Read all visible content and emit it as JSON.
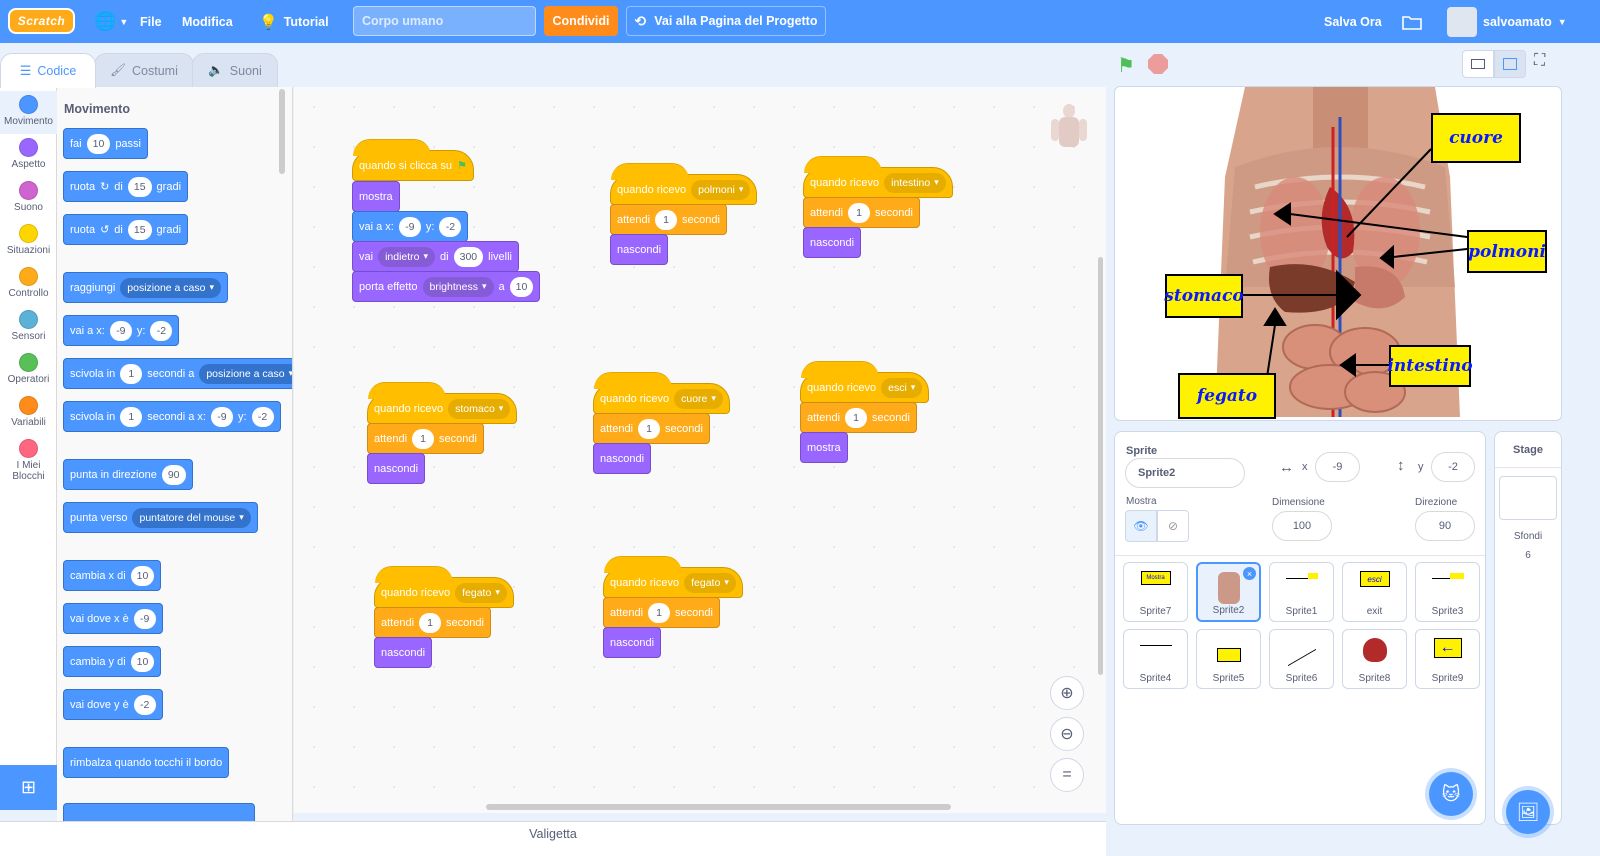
{
  "menubar": {
    "logo": "Scratch",
    "language_icon": "globe-icon",
    "file": "File",
    "edit": "Modifica",
    "tutorial": "Tutorial",
    "project_title": "Corpo umano",
    "share": "Condividi",
    "project_page": "Vai alla Pagina del Progetto",
    "save_now": "Salva Ora",
    "username": "salvoamato",
    "accent": "#4c97ff"
  },
  "tabs": {
    "code": "Codice",
    "costumes": "Costumi",
    "sounds": "Suoni"
  },
  "categories": [
    {
      "label": "Movimento",
      "color": "#4c97ff"
    },
    {
      "label": "Aspetto",
      "color": "#9966ff"
    },
    {
      "label": "Suono",
      "color": "#cf63cf"
    },
    {
      "label": "Situazioni",
      "color": "#ffd500"
    },
    {
      "label": "Controllo",
      "color": "#ffab19"
    },
    {
      "label": "Sensori",
      "color": "#5cb1d6"
    },
    {
      "label": "Operatori",
      "color": "#59c059"
    },
    {
      "label": "Variabili",
      "color": "#ff8c1a"
    },
    {
      "label": "I Miei Blocchi",
      "color": "#ff6680"
    }
  ],
  "palette": {
    "title": "Movimento",
    "move": {
      "a": "fai",
      "n": "10",
      "b": "passi"
    },
    "turn_right": {
      "a": "ruota",
      "b": "di",
      "n": "15",
      "c": "gradi"
    },
    "turn_left": {
      "a": "ruota",
      "b": "di",
      "n": "15",
      "c": "gradi"
    },
    "goto": {
      "a": "raggiungi",
      "opt": "posizione a caso"
    },
    "gotoxy": {
      "a": "vai a x:",
      "x": "-9",
      "b": "y:",
      "y": "-2"
    },
    "glide": {
      "a": "scivola in",
      "n": "1",
      "b": "secondi a",
      "opt": "posizione a caso"
    },
    "glidexy": {
      "a": "scivola in",
      "n": "1",
      "b": "secondi a x:",
      "x": "-9",
      "c": "y:",
      "y": "-2"
    },
    "point_dir": {
      "a": "punta in direzione",
      "n": "90"
    },
    "point_to": {
      "a": "punta verso",
      "opt": "puntatore del mouse"
    },
    "change_x": {
      "a": "cambia x di",
      "n": "10"
    },
    "set_x": {
      "a": "vai dove x è",
      "n": "-9"
    },
    "change_y": {
      "a": "cambia y di",
      "n": "10"
    },
    "set_y": {
      "a": "vai dove y è",
      "n": "-2"
    },
    "bounce": "rimbalza quando tocchi il bordo"
  },
  "scripts": {
    "flag": {
      "hat": "quando si clicca su",
      "show": "mostra",
      "gotoxy_a": "vai a x:",
      "x": "-9",
      "gotoxy_b": "y:",
      "y": "-2",
      "layer_a": "vai",
      "layer_opt": "indietro",
      "layer_b": "di",
      "layer_n": "300",
      "layer_c": "livelli",
      "effect_a": "porta effetto",
      "effect_opt": "brightness",
      "effect_b": "a",
      "effect_n": "10"
    },
    "polmoni": {
      "hat": "quando ricevo",
      "msg": "polmoni",
      "wait_a": "attendi",
      "wait_n": "1",
      "wait_b": "secondi",
      "action": "nascondi"
    },
    "intestino": {
      "hat": "quando ricevo",
      "msg": "intestino",
      "wait_a": "attendi",
      "wait_n": "1",
      "wait_b": "secondi",
      "action": "nascondi"
    },
    "stomaco": {
      "hat": "quando ricevo",
      "msg": "stomaco",
      "wait_a": "attendi",
      "wait_n": "1",
      "wait_b": "secondi",
      "action": "nascondi"
    },
    "cuore": {
      "hat": "quando ricevo",
      "msg": "cuore",
      "wait_a": "attendi",
      "wait_n": "1",
      "wait_b": "secondi",
      "action": "nascondi"
    },
    "esci": {
      "hat": "quando ricevo",
      "msg": "esci",
      "wait_a": "attendi",
      "wait_n": "1",
      "wait_b": "secondi",
      "action": "mostra"
    },
    "fegato": {
      "hat": "quando ricevo",
      "msg": "fegato",
      "wait_a": "attendi",
      "wait_n": "1",
      "wait_b": "secondi",
      "action": "nascondi"
    },
    "fegato2": {
      "hat": "quando ricevo",
      "msg": "fegato",
      "wait_a": "attendi",
      "wait_n": "1",
      "wait_b": "secondi",
      "action": "nascondi"
    }
  },
  "stage": {
    "labels": {
      "cuore": "cuore",
      "polmoni": "polmoni",
      "stomaco": "stomaco",
      "intestino": "intestino",
      "fegato": "fegato"
    }
  },
  "sprite_info": {
    "sprite_label": "Sprite",
    "name": "Sprite2",
    "x_label": "x",
    "x": "-9",
    "y_label": "y",
    "y": "-2",
    "show_label": "Mostra",
    "size_label": "Dimensione",
    "size": "100",
    "direction_label": "Direzione",
    "direction": "90"
  },
  "sprites": [
    "Sprite7",
    "Sprite2",
    "Sprite1",
    "exit",
    "Sprite3",
    "Sprite4",
    "Sprite5",
    "Sprite6",
    "Sprite8",
    "Sprite9"
  ],
  "sprite_thumbs": {
    "sprite7_text": "Mostra",
    "exit_text": "esci"
  },
  "stage_panel": {
    "title": "Stage",
    "backdrops_label": "Sfondi",
    "backdrops_count": "6"
  },
  "backpack": "Valigetta"
}
